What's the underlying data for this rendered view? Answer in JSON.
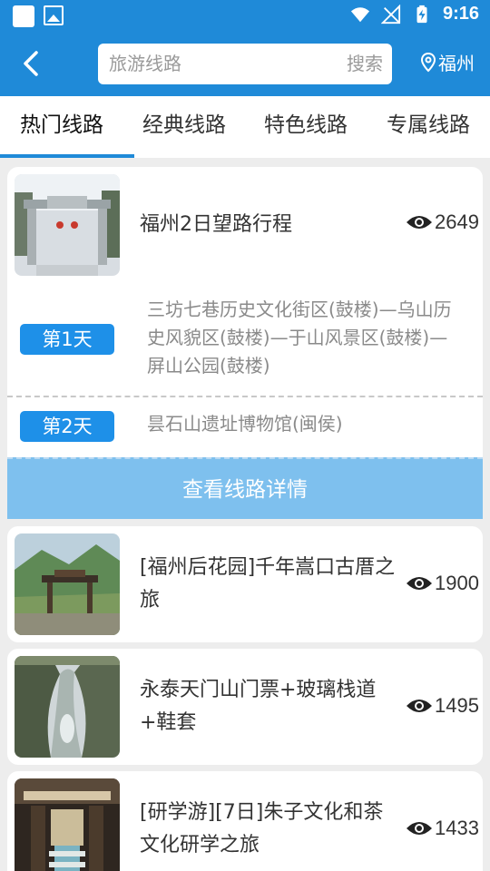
{
  "status_bar": {
    "time": "9:16"
  },
  "header": {
    "search_placeholder": "旅游线路",
    "search_button": "搜索",
    "city": "福州"
  },
  "tabs": [
    {
      "label": "热门线路",
      "active": true
    },
    {
      "label": "经典线路",
      "active": false
    },
    {
      "label": "特色线路",
      "active": false
    },
    {
      "label": "专属线路",
      "active": false
    }
  ],
  "routes": [
    {
      "title": "福州2日望路行程",
      "views": "2649"
    },
    {
      "title": "[福州后花园]千年嵩口古厝之旅",
      "views": "1900"
    },
    {
      "title": "永泰天门山门票+玻璃栈道+鞋套",
      "views": "1495"
    },
    {
      "title": "[研学游][7日]朱子文化和茶文化研学之旅",
      "views": "1433"
    }
  ],
  "itinerary": [
    {
      "day": "第1天",
      "text": "三坊七巷历史文化街区(鼓楼)—乌山历史风貌区(鼓楼)—于山风景区(鼓楼)—屏山公园(鼓楼)"
    },
    {
      "day": "第2天",
      "text": "昙石山遗址博物馆(闽侯)"
    }
  ],
  "detail_button": "查看线路详情",
  "colors": {
    "brand_blue": "#1f8ad8",
    "badge_blue": "#1e90e8",
    "detail_button_bg": "#7ec0ee"
  }
}
